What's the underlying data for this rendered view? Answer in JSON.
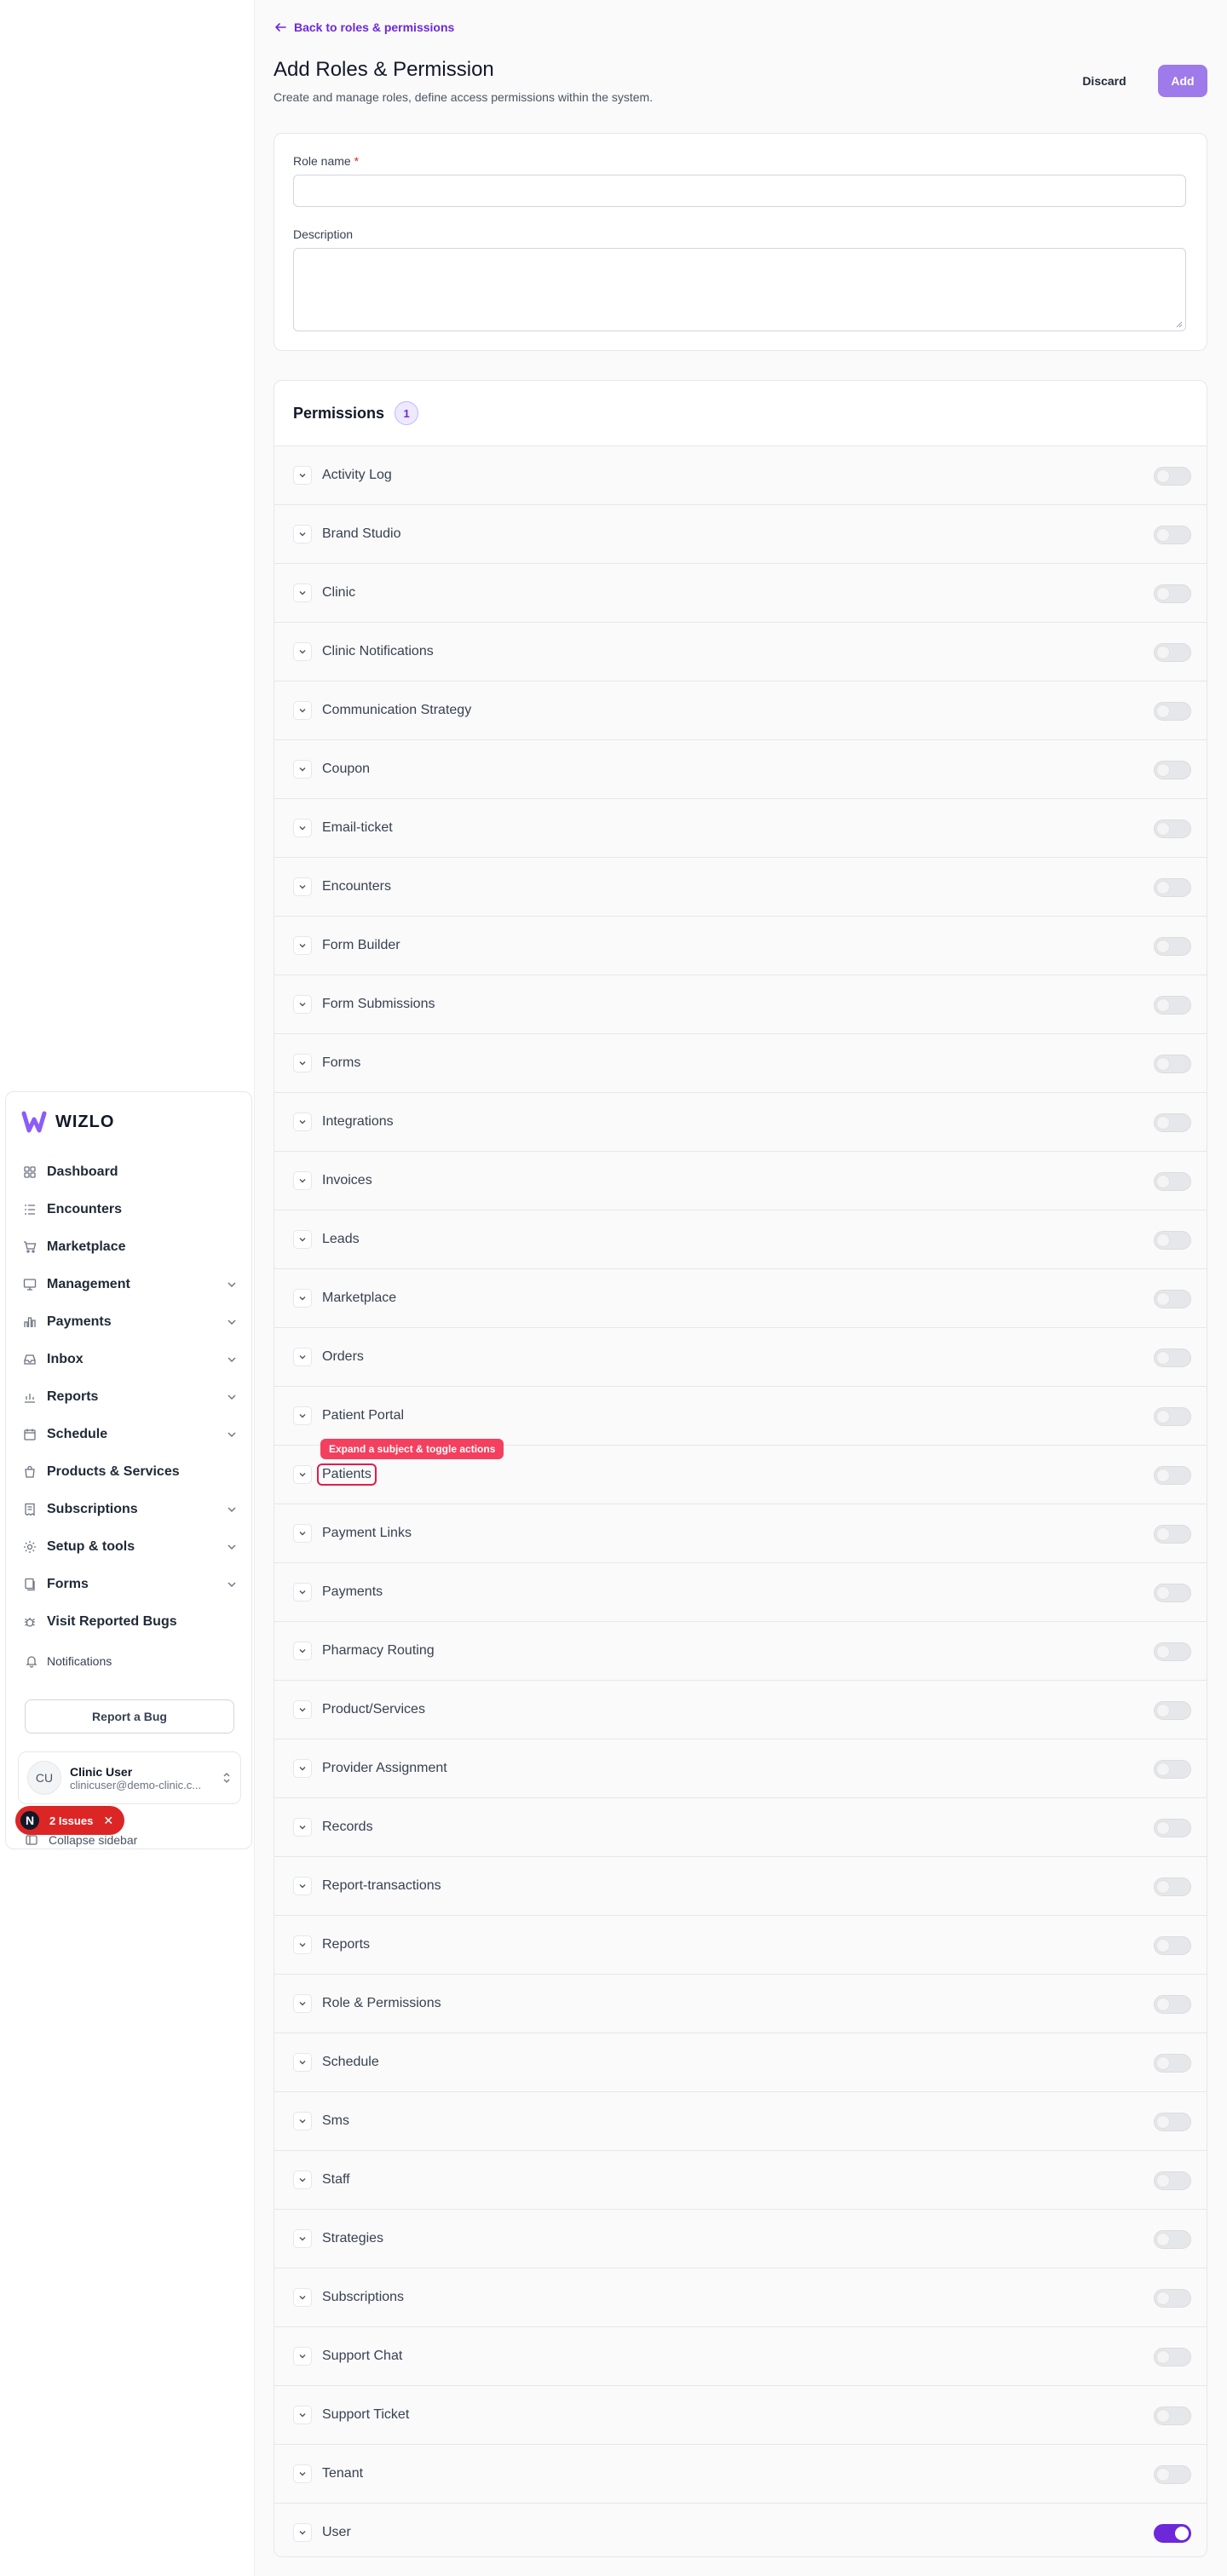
{
  "brand": {
    "name": "WIZLO"
  },
  "sidebar": {
    "items": [
      {
        "label": "Dashboard",
        "icon": "dashboard-icon",
        "expandable": false
      },
      {
        "label": "Encounters",
        "icon": "list-icon",
        "expandable": false
      },
      {
        "label": "Marketplace",
        "icon": "cart-icon",
        "expandable": false
      },
      {
        "label": "Management",
        "icon": "desktop-icon",
        "expandable": true
      },
      {
        "label": "Payments",
        "icon": "bar-chart-icon",
        "expandable": true
      },
      {
        "label": "Inbox",
        "icon": "inbox-icon",
        "expandable": true
      },
      {
        "label": "Reports",
        "icon": "chart-icon",
        "expandable": true
      },
      {
        "label": "Schedule",
        "icon": "calendar-icon",
        "expandable": true
      },
      {
        "label": "Products & Services",
        "icon": "bag-icon",
        "expandable": false
      },
      {
        "label": "Subscriptions",
        "icon": "receipt-icon",
        "expandable": true
      },
      {
        "label": "Setup & tools",
        "icon": "gear-icon",
        "expandable": true
      },
      {
        "label": "Forms",
        "icon": "forms-icon",
        "expandable": true
      },
      {
        "label": "Visit Reported Bugs",
        "icon": "bug-icon",
        "expandable": false
      }
    ],
    "notifications_label": "Notifications",
    "report_bug_label": "Report a Bug",
    "user": {
      "initials": "CU",
      "name": "Clinic User",
      "email": "clinicuser@demo-clinic.c..."
    },
    "collapse_label": "Collapse sidebar"
  },
  "issues_badge": {
    "letter": "N",
    "label": "2 Issues"
  },
  "header": {
    "back_label": "Back to roles & permissions",
    "title": "Add Roles & Permission",
    "subtitle": "Create and manage roles, define access permissions within the system.",
    "discard_label": "Discard",
    "add_label": "Add"
  },
  "form": {
    "role_name_label": "Role name",
    "required_mark": "*",
    "role_name_value": "",
    "description_label": "Description",
    "description_value": ""
  },
  "permissions": {
    "title": "Permissions",
    "count": "1",
    "tooltip": "Expand a subject & toggle actions",
    "items": [
      {
        "name": "Activity Log",
        "enabled": false
      },
      {
        "name": "Brand Studio",
        "enabled": false
      },
      {
        "name": "Clinic",
        "enabled": false
      },
      {
        "name": "Clinic Notifications",
        "enabled": false
      },
      {
        "name": "Communication Strategy",
        "enabled": false
      },
      {
        "name": "Coupon",
        "enabled": false
      },
      {
        "name": "Email-ticket",
        "enabled": false
      },
      {
        "name": "Encounters",
        "enabled": false
      },
      {
        "name": "Form Builder",
        "enabled": false
      },
      {
        "name": "Form Submissions",
        "enabled": false
      },
      {
        "name": "Forms",
        "enabled": false
      },
      {
        "name": "Integrations",
        "enabled": false
      },
      {
        "name": "Invoices",
        "enabled": false
      },
      {
        "name": "Leads",
        "enabled": false
      },
      {
        "name": "Marketplace",
        "enabled": false
      },
      {
        "name": "Orders",
        "enabled": false
      },
      {
        "name": "Patient Portal",
        "enabled": false
      },
      {
        "name": "Patients",
        "enabled": false,
        "highlighted": true
      },
      {
        "name": "Payment Links",
        "enabled": false
      },
      {
        "name": "Payments",
        "enabled": false
      },
      {
        "name": "Pharmacy Routing",
        "enabled": false
      },
      {
        "name": "Product/Services",
        "enabled": false
      },
      {
        "name": "Provider Assignment",
        "enabled": false
      },
      {
        "name": "Records",
        "enabled": false
      },
      {
        "name": "Report-transactions",
        "enabled": false
      },
      {
        "name": "Reports",
        "enabled": false
      },
      {
        "name": "Role & Permissions",
        "enabled": false
      },
      {
        "name": "Schedule",
        "enabled": false
      },
      {
        "name": "Sms",
        "enabled": false
      },
      {
        "name": "Staff",
        "enabled": false
      },
      {
        "name": "Strategies",
        "enabled": false
      },
      {
        "name": "Subscriptions",
        "enabled": false
      },
      {
        "name": "Support Chat",
        "enabled": false
      },
      {
        "name": "Support Ticket",
        "enabled": false
      },
      {
        "name": "Tenant",
        "enabled": false
      },
      {
        "name": "User",
        "enabled": true
      }
    ]
  },
  "colors": {
    "accent": "#6d28d9",
    "add_button": "#9f7aea",
    "issues": "#dc2626",
    "tooltip": "#f43f5e"
  }
}
